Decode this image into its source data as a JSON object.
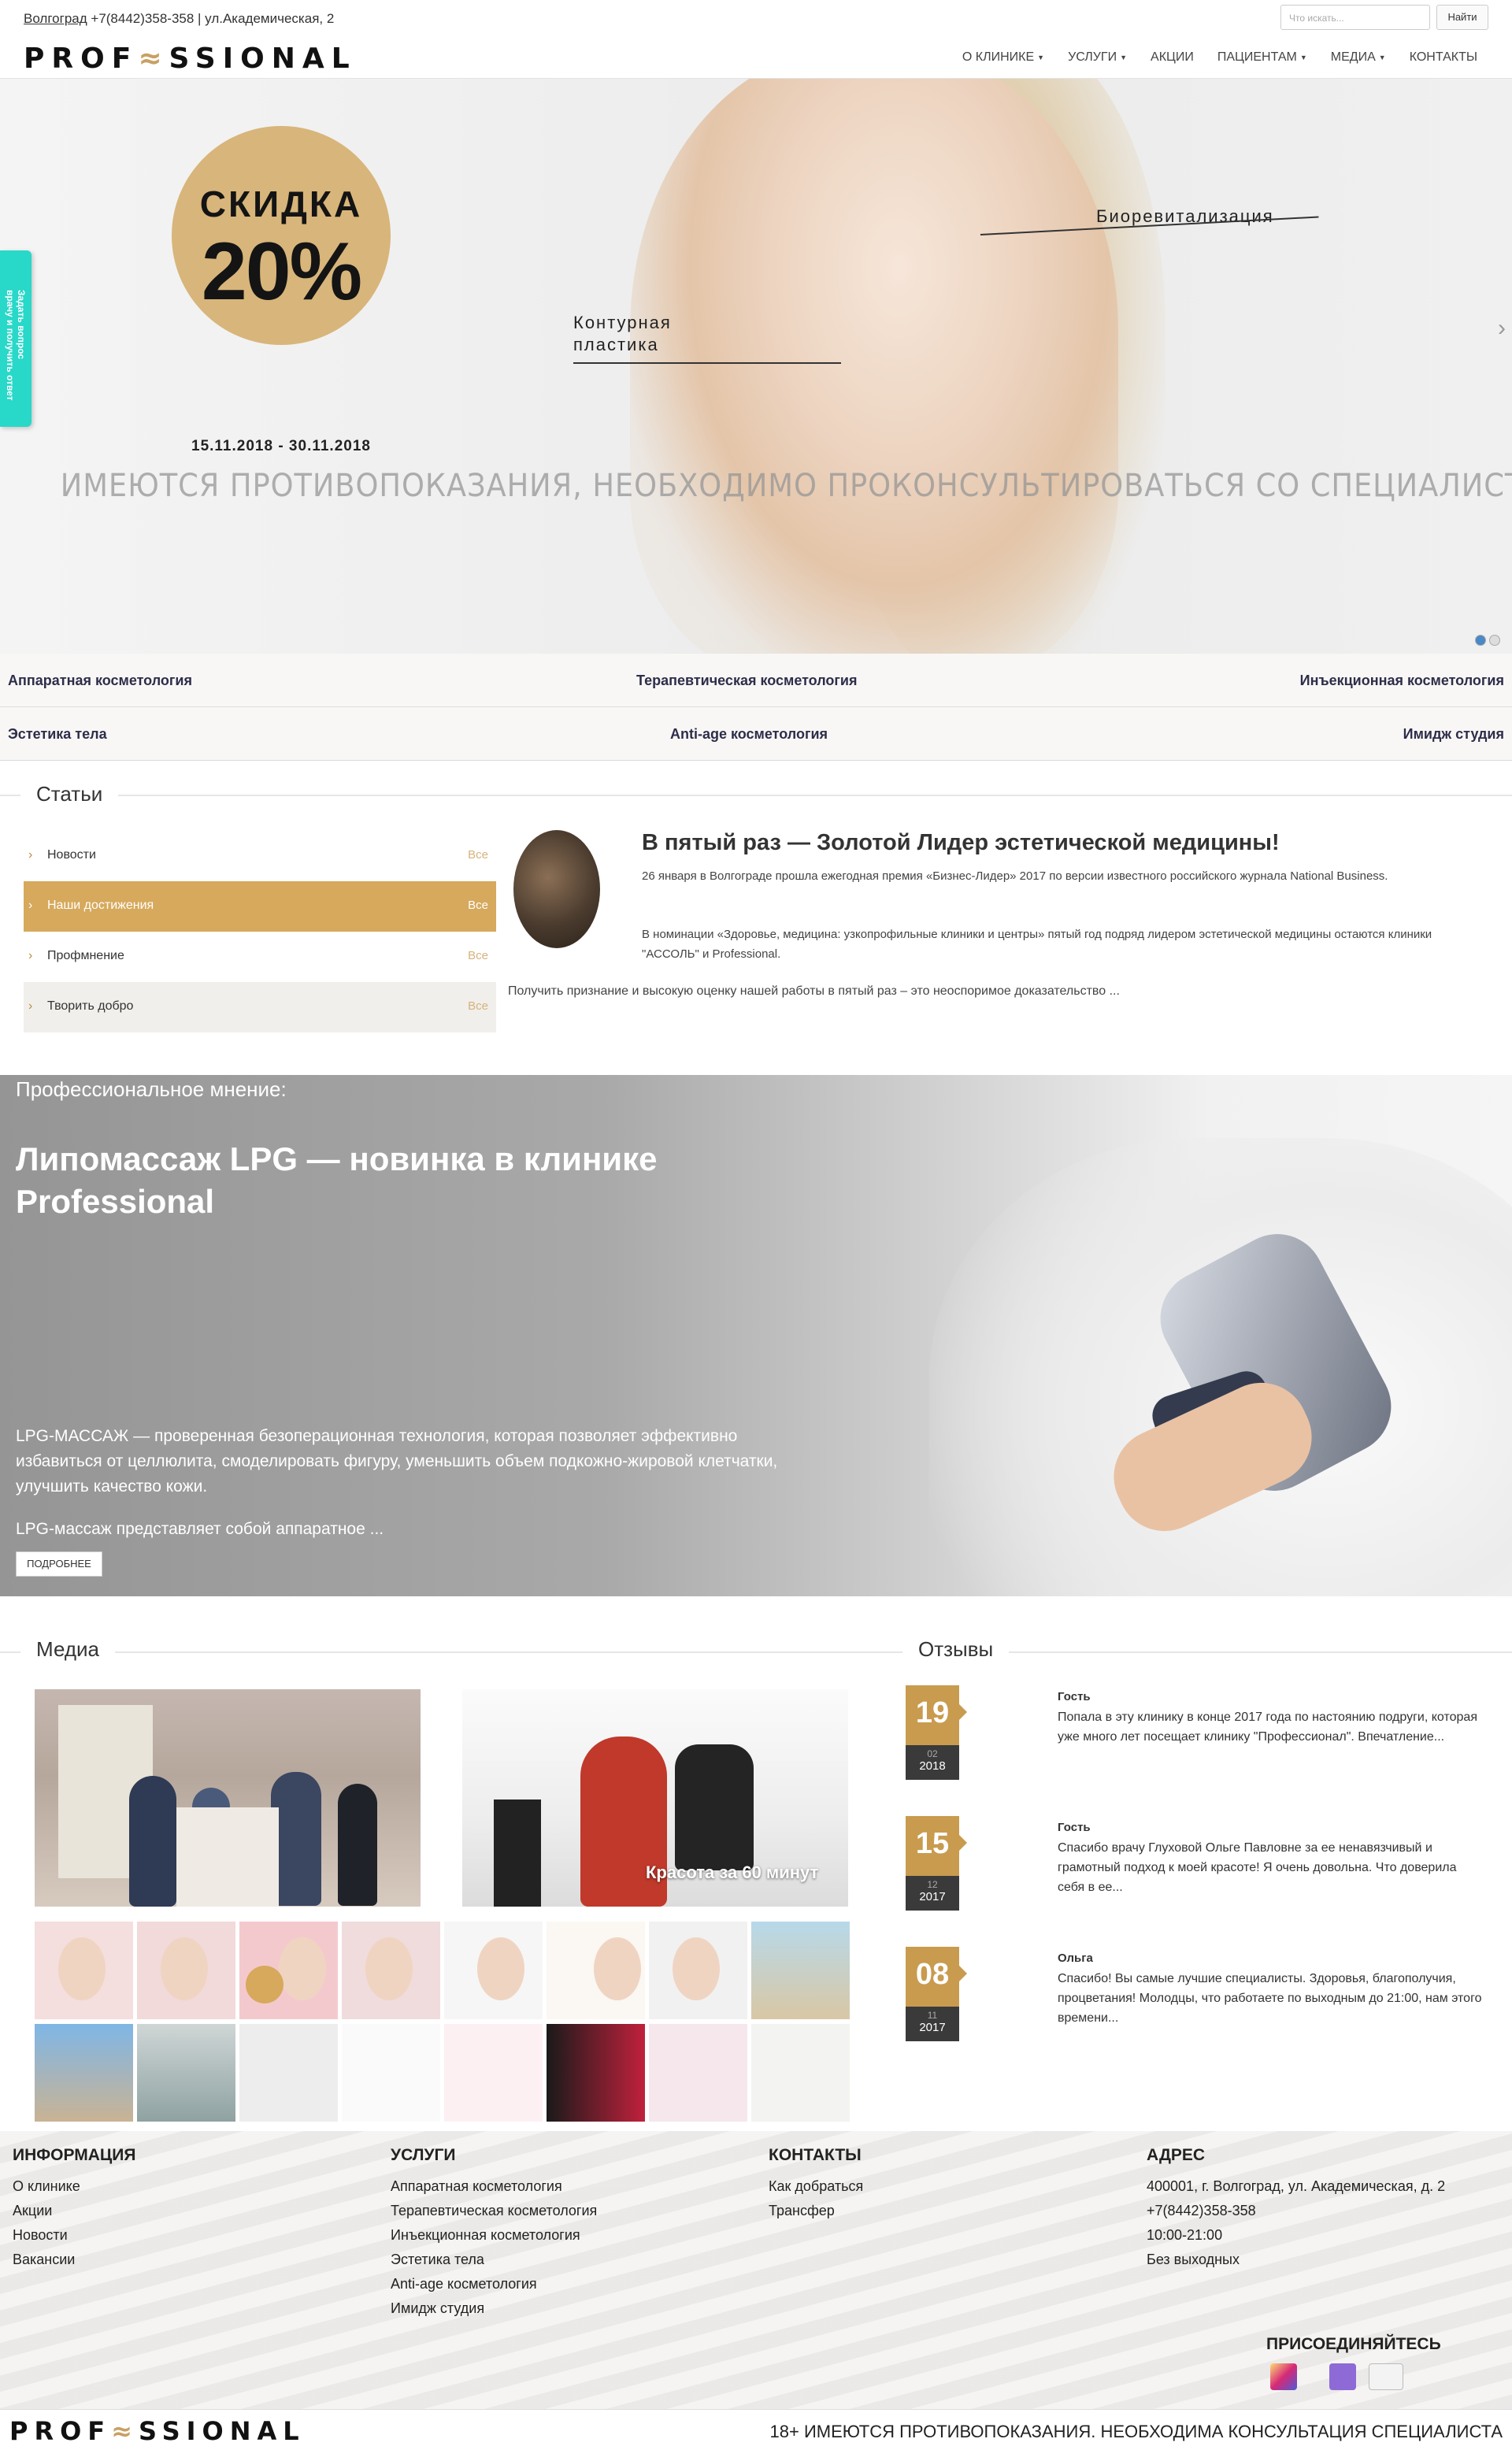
{
  "header": {
    "city": "Волгоград",
    "phone": "+7(8442)358-358",
    "address": "| ул.Академическая, 2",
    "logo_left": "PROF",
    "logo_mark": "≈",
    "logo_right": "SSIONAL",
    "search_placeholder": "Что искать...",
    "search_button": "Найти",
    "nav": [
      "О КЛИНИКЕ",
      "УСЛУГИ",
      "АКЦИИ",
      "ПАЦИЕНТАМ",
      "МЕДИА",
      "КОНТАКТЫ"
    ]
  },
  "side_tab": "Задать вопрос\nврачу и получить ответ",
  "hero": {
    "sale_label": "СКИДКА",
    "sale_value": "20%",
    "dates": "15.11.2018 - 30.11.2018",
    "label_bio": "Биоревитализация",
    "label_contour": "Контурная\nпластика",
    "disclaimer": "ИМЕЮТСЯ ПРОТИВОПОКАЗАНИЯ, НЕОБХОДИМО ПРОКОНСУЛЬТИРОВАТЬСЯ СО СПЕЦИАЛИСТОМ",
    "arrow": "›"
  },
  "services_row1": [
    "Аппаратная косметология",
    "Терапевтическая косметология",
    "Инъекционная косметология"
  ],
  "services_row2": [
    "Эстетика тела",
    "Anti-age косметология",
    "Имидж студия"
  ],
  "articles": {
    "title": "Статьи",
    "categories": [
      {
        "label": "Новости",
        "all": "Все"
      },
      {
        "label": "Наши достижения",
        "all": "Все"
      },
      {
        "label": "Профмнение",
        "all": "Все"
      },
      {
        "label": "Творить добро",
        "all": "Все"
      }
    ],
    "headline": "В пятый раз — Золотой Лидер эстетической медицины!",
    "p1": "26 января в Волгограде прошла ежегодная премия «Бизнес-Лидер» 2017 по версии известного российского журнала National Business.",
    "p2": "В номинации «Здоровье, медицина: узкопрофильные клиники и центры» пятый год подряд лидером эстетической медицины остаются клиники \"АССОЛЬ\" и Professional.",
    "p3": "Получить признание и высокую оценку нашей работы в пятый раз – это неоспоримое доказательство ..."
  },
  "opinion": {
    "kicker": "Профессиональное мнение:",
    "title": "Липомассаж LPG — новинка в клинике Professional",
    "text": "LPG-МАССАЖ — проверенная безоперационная технология, которая позволяет эффективно избавиться от целлюлита, смоделировать фигуру, уменьшить объем подкожно-жировой клетчатки, улучшить качество кожи.",
    "text2": "LPG-массаж представляет собой аппаратное ...",
    "button": "ПОДРОБНЕЕ"
  },
  "media": {
    "title": "Медиа",
    "video2_caption": "Красота за 60 минут"
  },
  "reviews": {
    "title": "Отзывы",
    "items": [
      {
        "day": "19",
        "month": "02",
        "year": "2018",
        "name": "Гость",
        "text": "Попала в эту клинику в конце 2017 года по настоянию подруги, которая уже много лет посещает клинику \"Профессионал\". Впечатление..."
      },
      {
        "day": "15",
        "month": "12",
        "year": "2017",
        "name": "Гость",
        "text": "Спасибо врачу Глуховой Ольге Павловне за ее ненавязчивый и грамотный подход к моей красоте! Я очень довольна. Что доверила себя в ее..."
      },
      {
        "day": "08",
        "month": "11",
        "year": "2017",
        "name": "Ольга",
        "text": "Спасибо! Вы самые лучшие специалисты. Здоровья, благополучия, процветания! Молодцы, что работаете по выходным до 21:00, нам этого времени..."
      }
    ]
  },
  "footer": {
    "info_title": "ИНФОРМАЦИЯ",
    "info": [
      "О клинике",
      "Акции",
      "Новости",
      "Вакансии"
    ],
    "services_title": "УСЛУГИ",
    "services": [
      "Аппаратная косметология",
      "Терапевтическая косметология",
      "Инъекционная косметология",
      "Эстетика тела",
      "Anti-age косметология",
      "Имидж студия"
    ],
    "contacts_title": "КОНТАКТЫ",
    "contacts": [
      "Как добраться",
      "Трансфер"
    ],
    "address_title": "АДРЕС",
    "address": [
      "400001, г. Волгоград, ул. Академическая, д. 2",
      "+7(8442)358-358",
      "10:00-21:00",
      "Без выходных"
    ],
    "join": "ПРИСОЕДИНЯЙТЕСЬ",
    "disclaimer": "18+ ИМЕЮТСЯ ПРОТИВОПОКАЗАНИЯ. НЕОБХОДИМА КОНСУЛЬТАЦИЯ СПЕЦИАЛИСТА"
  },
  "colors": {
    "accent_gold": "#d6a95c",
    "side_tab": "#28d8c8",
    "text_dark": "#2d2d4a"
  }
}
